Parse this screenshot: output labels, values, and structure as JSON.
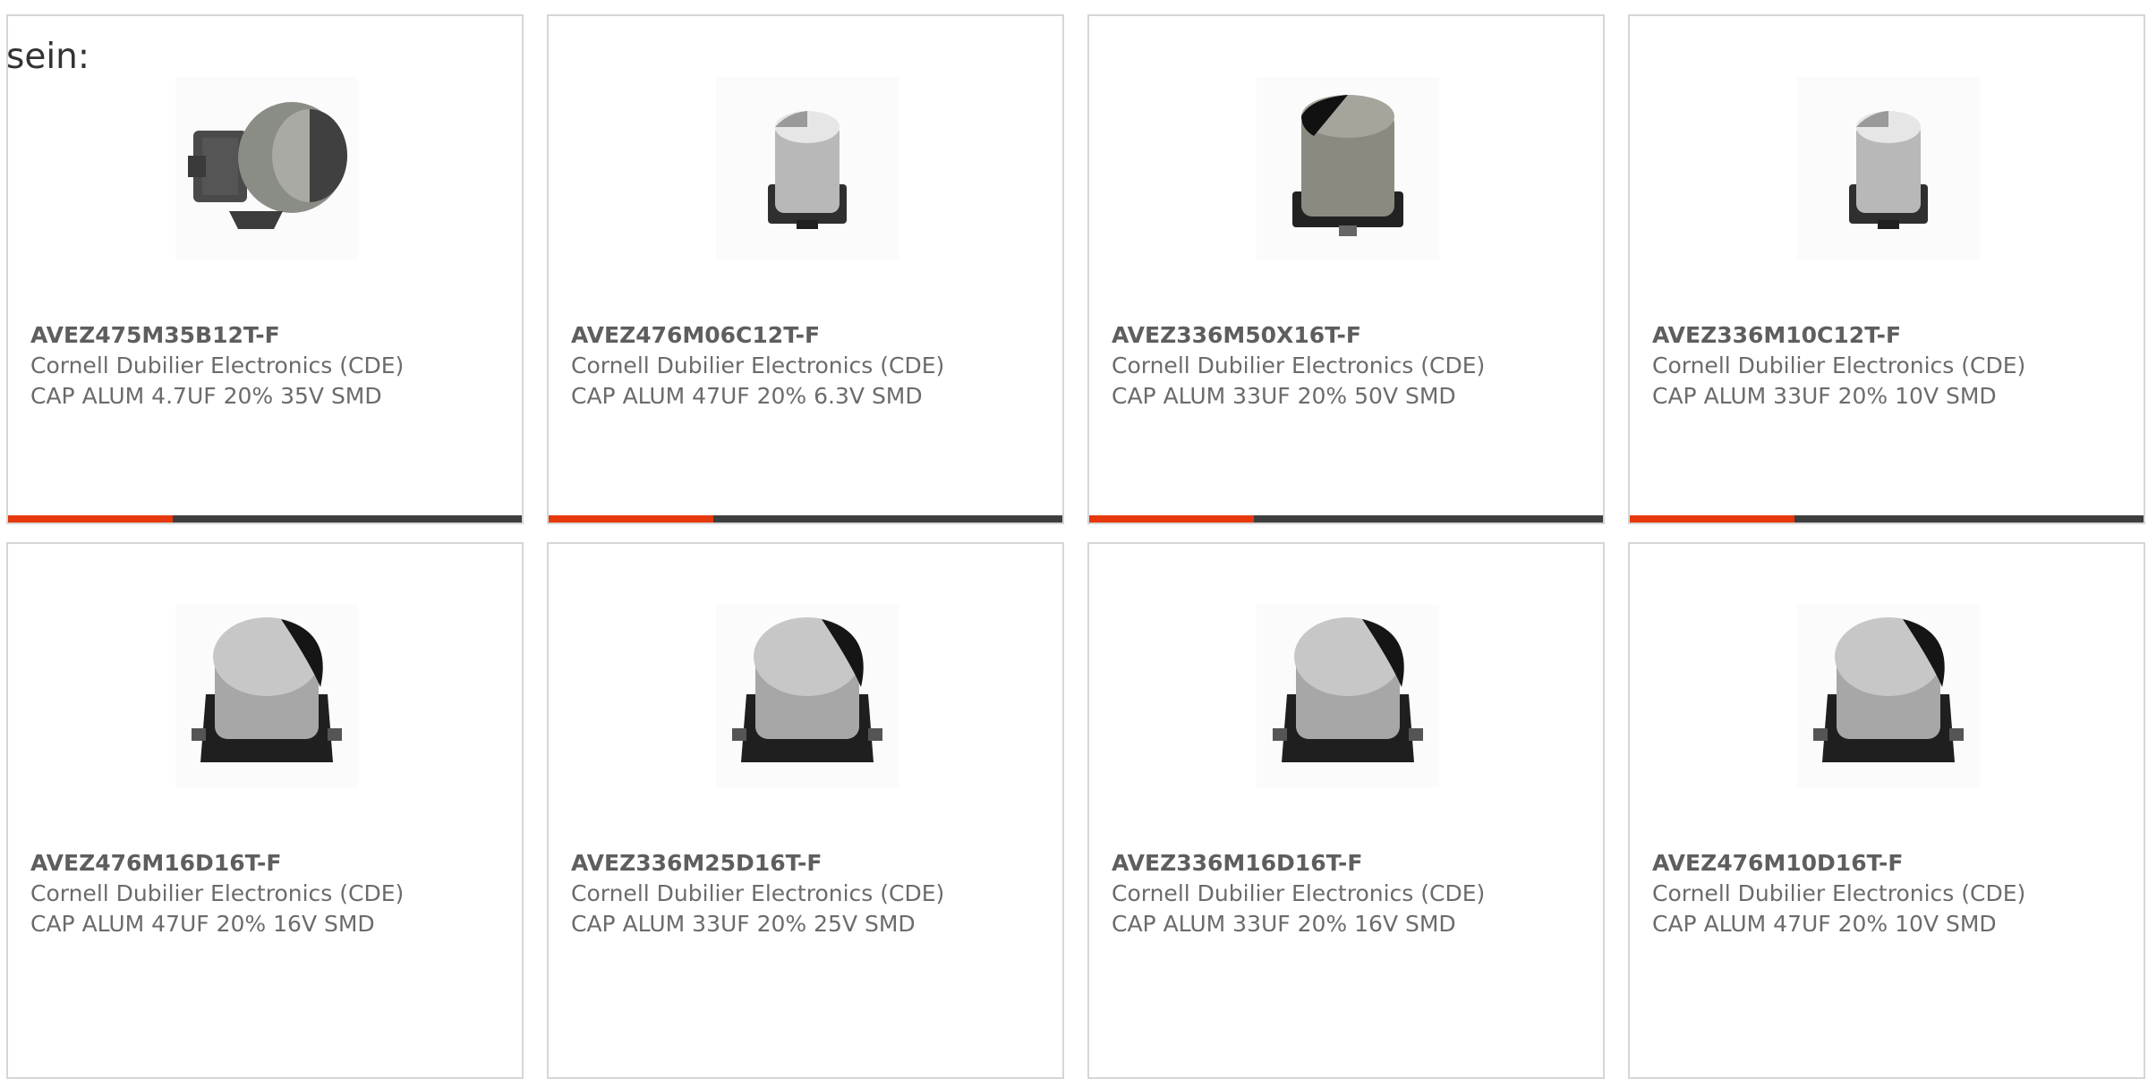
{
  "intro_text": "sein:",
  "colors": {
    "accent": "#e5380d",
    "track": "#3e3e3e",
    "border": "#d6d6d6"
  },
  "products": [
    {
      "part_number": "AVEZ475M35B12T-F",
      "manufacturer": "Cornell Dubilier Electronics (CDE)",
      "description": "CAP ALUM 4.7UF 20% 35V SMD",
      "image_icon": "capacitor-side-icon",
      "progress": 0.32
    },
    {
      "part_number": "AVEZ476M06C12T-F",
      "manufacturer": "Cornell Dubilier Electronics (CDE)",
      "description": "CAP ALUM 47UF 20% 6.3V SMD",
      "image_icon": "capacitor-small-icon",
      "progress": 0.32
    },
    {
      "part_number": "AVEZ336M50X16T-F",
      "manufacturer": "Cornell Dubilier Electronics (CDE)",
      "description": "CAP ALUM 33UF 20% 50V SMD",
      "image_icon": "capacitor-dark-icon",
      "progress": 0.32
    },
    {
      "part_number": "AVEZ336M10C12T-F",
      "manufacturer": "Cornell Dubilier Electronics (CDE)",
      "description": "CAP ALUM 33UF 20% 10V SMD",
      "image_icon": "capacitor-small-icon",
      "progress": 0.32
    },
    {
      "part_number": "AVEZ476M16D16T-F",
      "manufacturer": "Cornell Dubilier Electronics (CDE)",
      "description": "CAP ALUM 47UF 20% 16V SMD",
      "image_icon": "capacitor-large-icon"
    },
    {
      "part_number": "AVEZ336M25D16T-F",
      "manufacturer": "Cornell Dubilier Electronics (CDE)",
      "description": "CAP ALUM 33UF 20% 25V SMD",
      "image_icon": "capacitor-large-icon"
    },
    {
      "part_number": "AVEZ336M16D16T-F",
      "manufacturer": "Cornell Dubilier Electronics (CDE)",
      "description": "CAP ALUM 33UF 20% 16V SMD",
      "image_icon": "capacitor-large-icon"
    },
    {
      "part_number": "AVEZ476M10D16T-F",
      "manufacturer": "Cornell Dubilier Electronics (CDE)",
      "description": "CAP ALUM 47UF 20% 10V SMD",
      "image_icon": "capacitor-large-icon"
    }
  ]
}
